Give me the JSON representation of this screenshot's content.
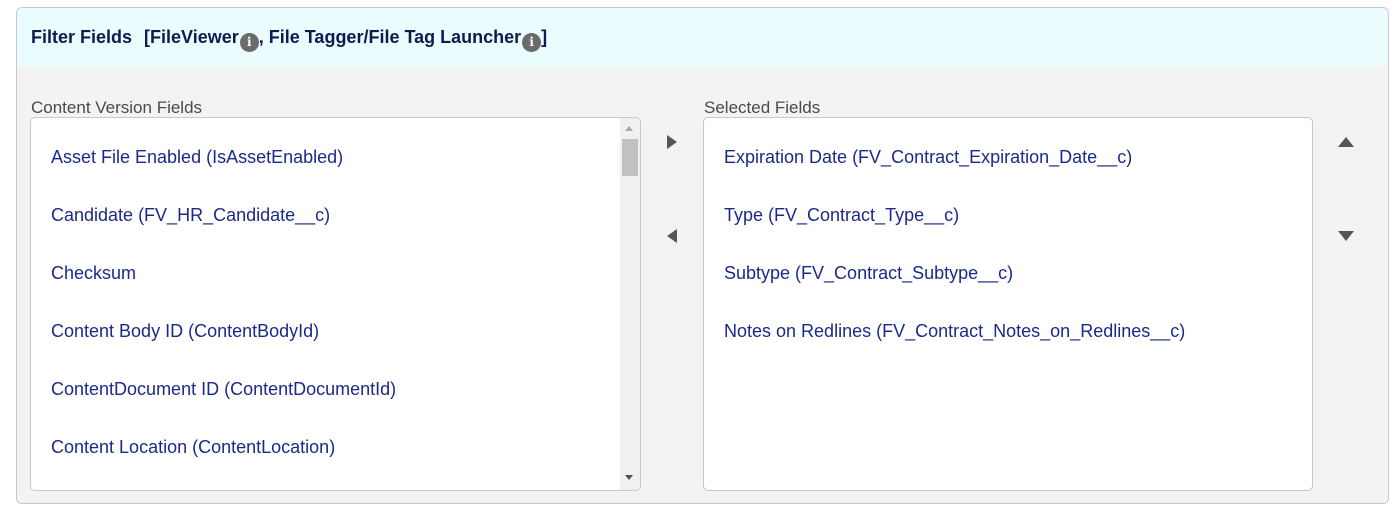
{
  "header": {
    "title": "Filter Fields",
    "bracket_open": "[",
    "link1": "FileViewer",
    "separator": ", ",
    "link2": "File Tagger/File Tag Launcher",
    "bracket_close": "]",
    "info_glyph": "i"
  },
  "available": {
    "label": "Content Version Fields",
    "items": [
      "Asset File Enabled (IsAssetEnabled)",
      "Candidate (FV_HR_Candidate__c)",
      "Checksum",
      "Content Body ID (ContentBodyId)",
      "ContentDocument ID (ContentDocumentId)",
      "Content Location (ContentLocation)"
    ]
  },
  "selected": {
    "label": "Selected Fields",
    "items": [
      "Expiration Date (FV_Contract_Expiration_Date__c)",
      "Type (FV_Contract_Type__c)",
      "Subtype (FV_Contract_Subtype__c)",
      "Notes on Redlines (FV_Contract_Notes_on_Redlines__c)"
    ]
  },
  "icons": {
    "info": "info-icon",
    "move_right": "triangle-right-icon",
    "move_left": "triangle-left-icon",
    "move_up": "triangle-up-icon",
    "move_down": "triangle-down-icon"
  },
  "colors": {
    "header_bg": "#eafcfd",
    "header_text": "#101a4e",
    "item_text": "#1b2a8a",
    "panel_bg": "#f3f3f3"
  }
}
